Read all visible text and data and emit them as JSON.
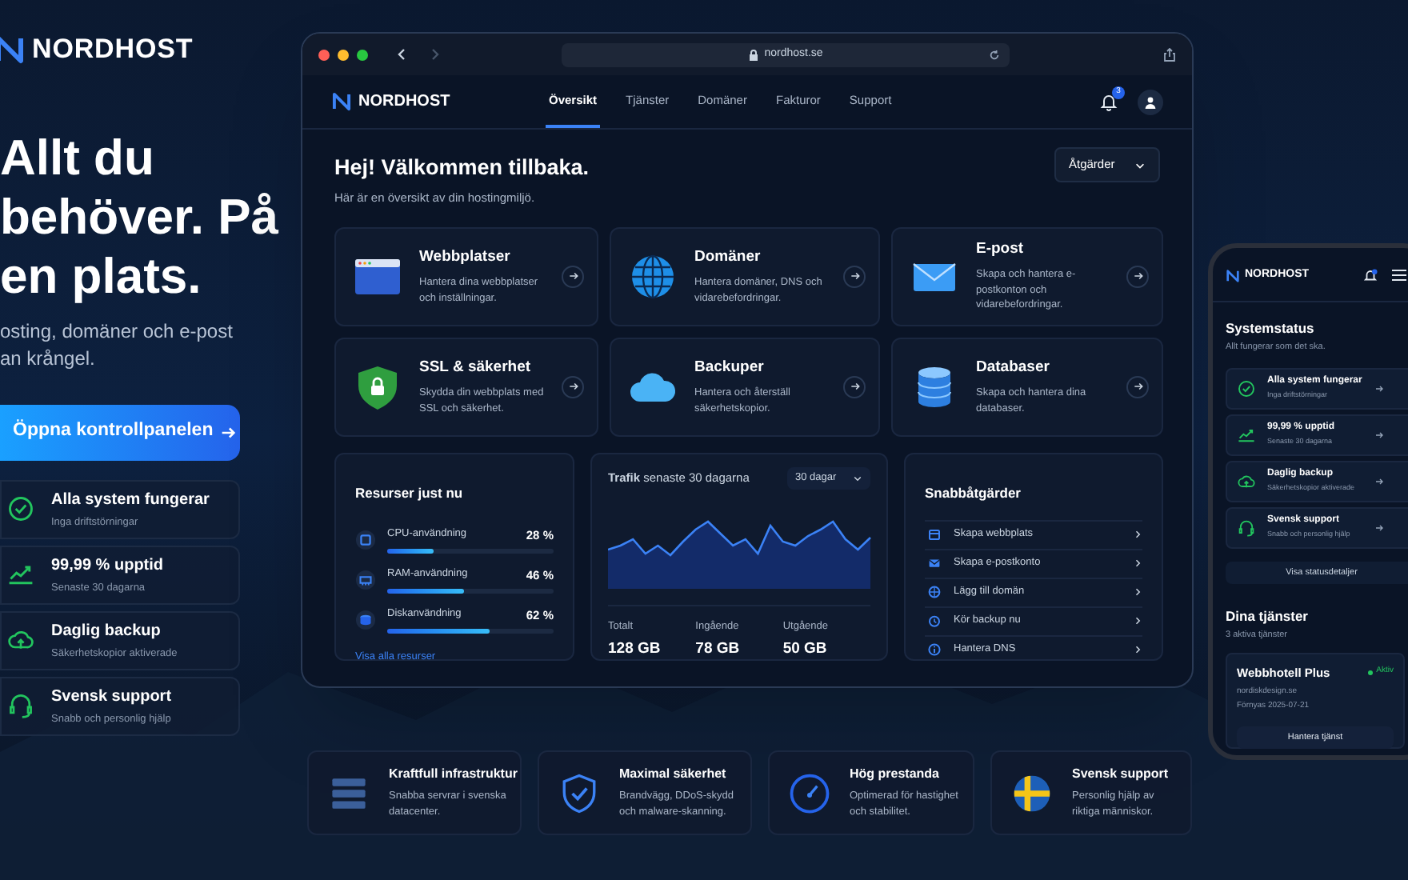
{
  "brand": {
    "name": "NORDHOST"
  },
  "hero": {
    "heading_lines": [
      "Allt du",
      "behöver. På",
      "en plats."
    ],
    "subtitle_lines": [
      "osting, domäner och e-post",
      "an krångel."
    ],
    "cta": "Öppna kontrollpanelen"
  },
  "status_cards": [
    {
      "kind": "check",
      "title": "Alla system fungerar",
      "subtitle": "Inga driftstörningar"
    },
    {
      "kind": "chart",
      "title": "99,99 % upptid",
      "subtitle": "Senaste 30 dagarna"
    },
    {
      "kind": "cloud",
      "title": "Daglig backup",
      "subtitle": "Säkerhetskopior aktiverade"
    },
    {
      "kind": "headset",
      "title": "Svensk support",
      "subtitle": "Snabb och personlig hjälp"
    }
  ],
  "browser": {
    "url": "nordhost.se",
    "brand": "NORDHOST",
    "tabs": [
      {
        "label": "Översikt",
        "selected": true
      },
      {
        "label": "Tjänster",
        "selected": false
      },
      {
        "label": "Domäner",
        "selected": false
      },
      {
        "label": "Fakturor",
        "selected": false
      },
      {
        "label": "Support",
        "selected": false
      }
    ],
    "notification_count": "3",
    "greeting": "Hej! Välkommen tillbaka.",
    "intro": "Här är en översikt av din hostingmiljö.",
    "actions_button": "Åtgärder",
    "services": [
      {
        "kind": "window",
        "title": "Webbplatser",
        "description": "Hantera dina webbplatser och inställningar."
      },
      {
        "kind": "globe",
        "title": "Domäner",
        "description": "Hantera domäner, DNS och vidarebefordringar."
      },
      {
        "kind": "mail",
        "title": "E-post",
        "description": "Skapa och hantera e-postkonton och vidarebefordringar."
      },
      {
        "kind": "shield",
        "title": "SSL & säkerhet",
        "description": "Skydda din webbplats med SSL och säkerhet."
      },
      {
        "kind": "cloud",
        "title": "Backuper",
        "description": "Hantera och återställ säkerhetskopior."
      },
      {
        "kind": "database",
        "title": "Databaser",
        "description": "Skapa och hantera dina databaser."
      }
    ],
    "resources": {
      "title": "Resurser just nu",
      "link": "Visa alla resurser",
      "meters": [
        {
          "kind": "cpu",
          "label": "CPU-användning",
          "reading": "28 %",
          "level": 0.28
        },
        {
          "kind": "ram",
          "label": "RAM-användning",
          "reading": "46 %",
          "level": 0.46
        },
        {
          "kind": "disk",
          "label": "Diskanvändning",
          "reading": "62 %",
          "level": 0.62
        }
      ]
    },
    "traffic": {
      "title": "**Trafik** senaste 30 dagarna",
      "range": "30 dagar",
      "totals": [
        {
          "label": "Totalt",
          "value": "128 GB"
        },
        {
          "label": "Ingående",
          "value": "78 GB"
        },
        {
          "label": "Utgående",
          "value": "50 GB"
        }
      ]
    },
    "quick_actions": {
      "title": "Snabbåtgärder",
      "items": [
        {
          "kind": "site",
          "label": "Skapa webbplats"
        },
        {
          "kind": "mail",
          "label": "Skapa e-postkonto"
        },
        {
          "kind": "globe",
          "label": "Lägg till domän"
        },
        {
          "kind": "backup",
          "label": "Kör backup nu"
        },
        {
          "kind": "dns",
          "label": "Hantera DNS"
        }
      ]
    }
  },
  "phone": {
    "brand": "NORDHOST",
    "title": "Systemstatus",
    "subtitle": "Allt fungerar som det ska.",
    "status_items": [
      {
        "kind": "check",
        "title": "Alla system fungerar",
        "subtitle": "Inga driftstörningar"
      },
      {
        "kind": "chart",
        "title": "99,99 % upptid",
        "subtitle": "Senaste 30 dagarna"
      },
      {
        "kind": "cloud",
        "title": "Daglig backup",
        "subtitle": "Säkerhetskopior aktiverade"
      },
      {
        "kind": "headset",
        "title": "Svensk support",
        "subtitle": "Snabb och personlig hjälp"
      }
    ],
    "details_button": "Visa statusdetaljer",
    "services_title": "Dina tjänster",
    "services_count": "3 aktiva tjänster",
    "service": {
      "name": "Webbhotell Plus",
      "status": "Aktiv",
      "domain": "nordiskdesign.se",
      "renewal": "Förnyas 2025-07-21",
      "button": "Hantera tjänst"
    }
  },
  "features": [
    {
      "kind": "servers",
      "title": "Kraftfull infrastruktur",
      "description": "Snabba servrar i svenska datacenter."
    },
    {
      "kind": "shield",
      "title": "Maximal säkerhet",
      "description": "Brandvägg, DDoS-skydd och malware-skanning."
    },
    {
      "kind": "gauge",
      "title": "Hög prestanda",
      "description": "Optimerad för hastighet och stabilitet."
    },
    {
      "kind": "flag",
      "title": "Svensk support",
      "description": "Personlig hjälp av riktiga människor."
    }
  ]
}
